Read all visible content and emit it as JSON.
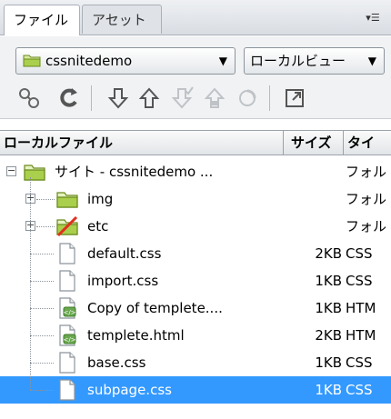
{
  "tabs": [
    {
      "label": "ファイル",
      "active": true
    },
    {
      "label": "アセット",
      "active": false
    }
  ],
  "tab_menu_icon": "panel-menu-icon",
  "site_select": {
    "value": "cssnitedemo",
    "icon": "folder-icon"
  },
  "view_select": {
    "value": "ローカルビュー"
  },
  "toolbar": [
    {
      "name": "connect-icon",
      "glyph": "⚯",
      "enabled": true
    },
    {
      "name": "refresh-icon",
      "glyph": "C",
      "enabled": true
    },
    {
      "name": "get-files-icon",
      "glyph": "⇩",
      "enabled": true
    },
    {
      "name": "put-files-icon",
      "glyph": "⇧",
      "enabled": true
    },
    {
      "name": "check-out-icon",
      "glyph": "⇩",
      "enabled": false
    },
    {
      "name": "check-in-icon",
      "glyph": "⇧",
      "enabled": false
    },
    {
      "name": "synchronize-icon",
      "glyph": "⟳",
      "enabled": false
    },
    {
      "name": "expand-icon",
      "glyph": "◳",
      "enabled": true
    }
  ],
  "columns": {
    "name": "ローカルファイル",
    "size": "サイズ",
    "type": "タイ"
  },
  "tree": [
    {
      "label": "サイト - cssnitedemo ...",
      "size": "",
      "type": "フォル",
      "kind": "site",
      "level": 0,
      "expander": "−"
    },
    {
      "label": "img",
      "size": "",
      "type": "フォル",
      "kind": "folder",
      "level": 1,
      "expander": "+"
    },
    {
      "label": "etc",
      "size": "",
      "type": "フォル",
      "kind": "folder-cloaked",
      "level": 1,
      "expander": "+"
    },
    {
      "label": "default.css",
      "size": "2KB",
      "type": "CSS",
      "kind": "file",
      "level": 1
    },
    {
      "label": "import.css",
      "size": "1KB",
      "type": "CSS",
      "kind": "file",
      "level": 1
    },
    {
      "label": "Copy of templete....",
      "size": "1KB",
      "type": "HTM",
      "kind": "html",
      "level": 1
    },
    {
      "label": "templete.html",
      "size": "2KB",
      "type": "HTM",
      "kind": "html",
      "level": 1
    },
    {
      "label": "base.css",
      "size": "1KB",
      "type": "CSS",
      "kind": "file",
      "level": 1
    },
    {
      "label": "subpage.css",
      "size": "1KB",
      "type": "CSS",
      "kind": "file",
      "level": 1,
      "selected": true
    }
  ]
}
